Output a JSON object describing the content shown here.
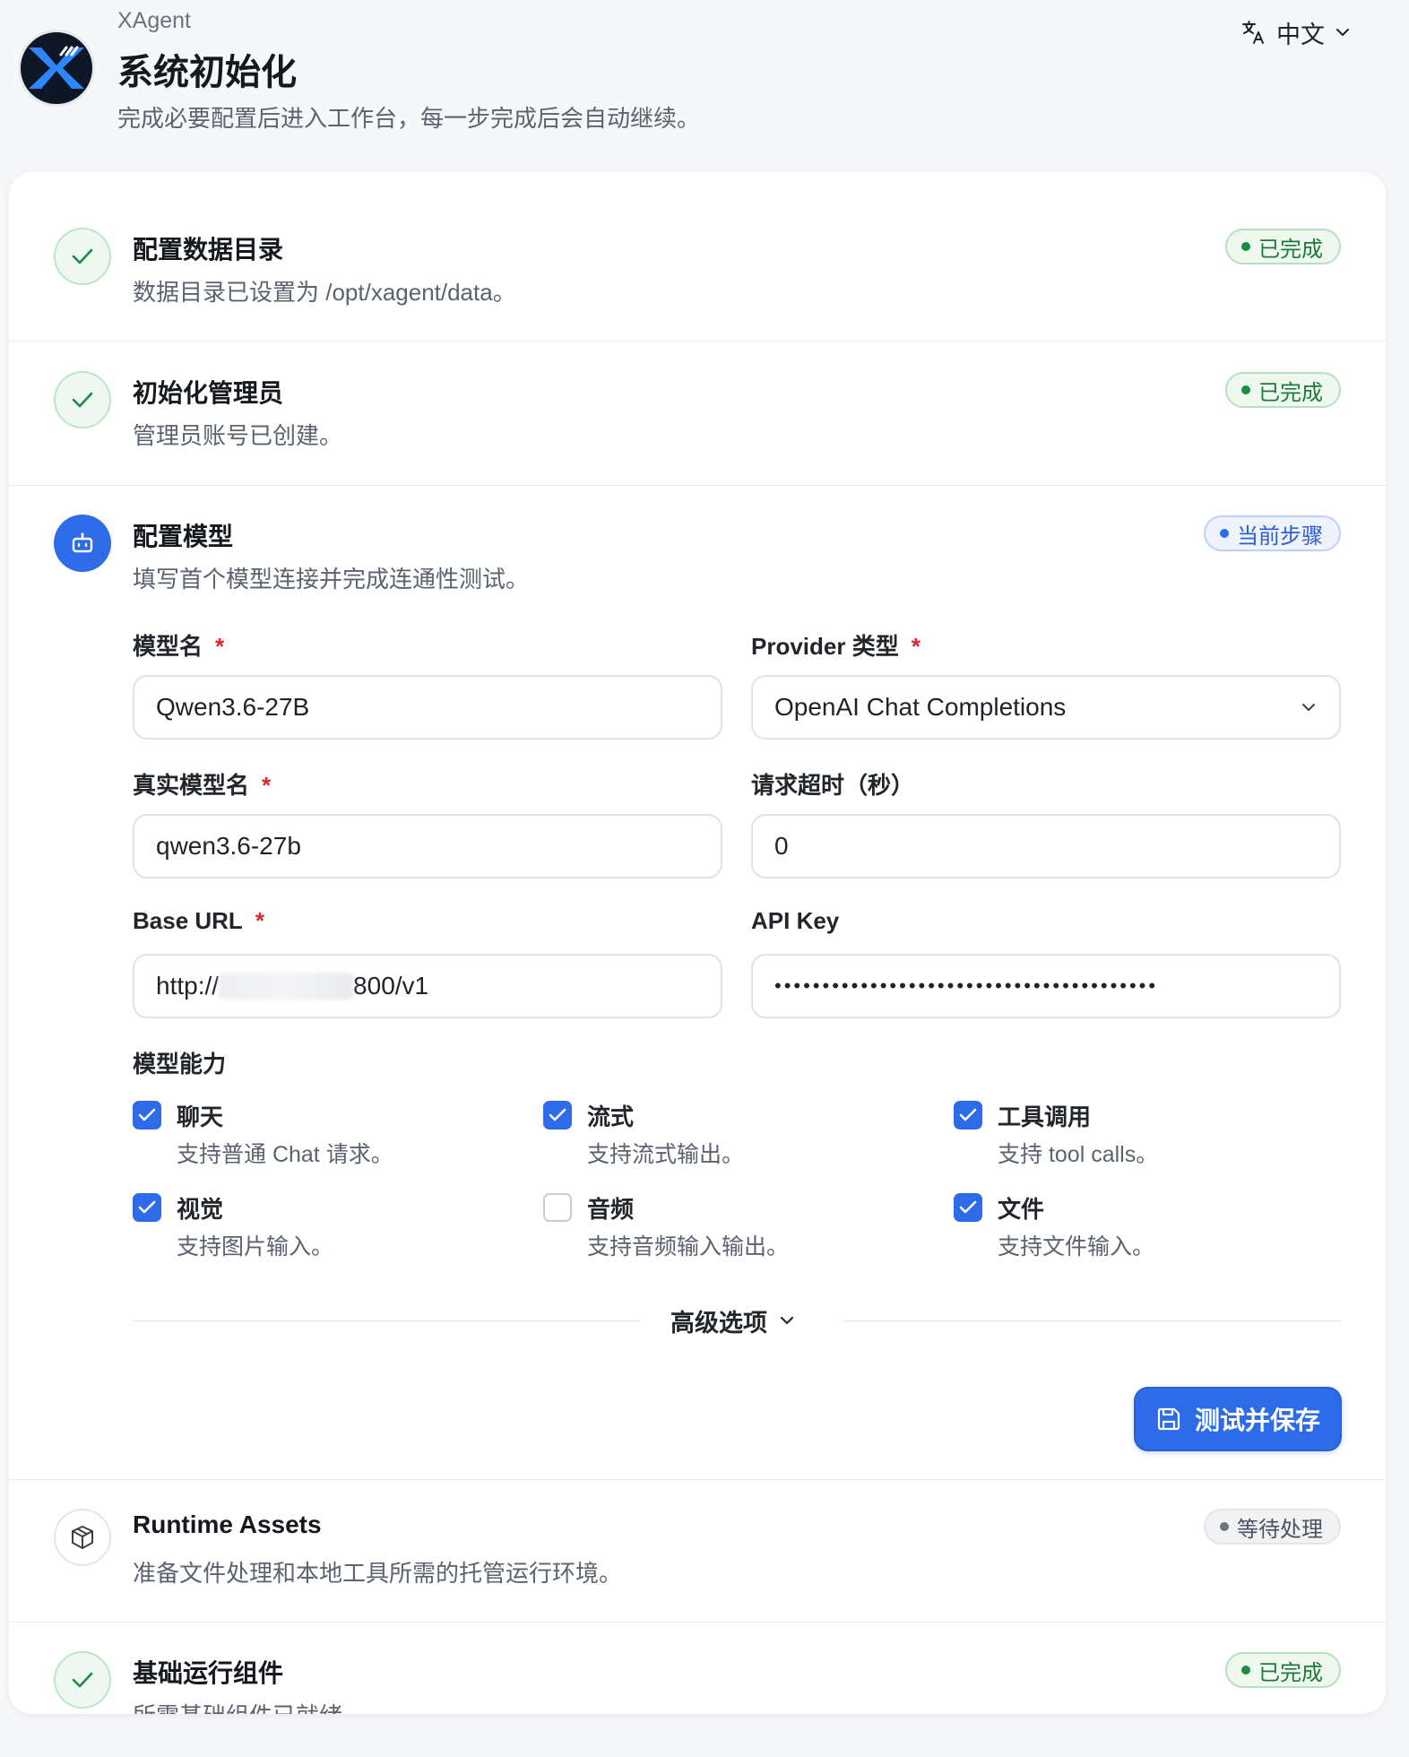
{
  "header": {
    "app_name": "XAgent",
    "title": "系统初始化",
    "subtitle": "完成必要配置后进入工作台，每一步完成后会自动继续。",
    "language": "中文"
  },
  "steps": [
    {
      "title": "配置数据目录",
      "desc": "数据目录已设置为 /opt/xagent/data。",
      "badge": "已完成",
      "status": "done",
      "icon": "check-icon"
    },
    {
      "title": "初始化管理员",
      "desc": "管理员账号已创建。",
      "badge": "已完成",
      "status": "done",
      "icon": "check-icon"
    },
    {
      "title": "配置模型",
      "desc": "填写首个模型连接并完成连通性测试。",
      "badge": "当前步骤",
      "status": "current",
      "icon": "robot-icon"
    },
    {
      "title": "Runtime Assets",
      "desc": "准备文件处理和本地工具所需的托管运行环境。",
      "badge": "等待处理",
      "status": "pending",
      "icon": "package-icon"
    },
    {
      "title": "基础运行组件",
      "desc": "所需基础组件已就绪。",
      "badge": "已完成",
      "status": "done",
      "icon": "check-icon"
    }
  ],
  "form": {
    "model_name": {
      "label": "模型名",
      "required": "*",
      "value": "Qwen3.6-27B"
    },
    "provider_type": {
      "label": "Provider 类型",
      "required": "*",
      "value": "OpenAI Chat Completions"
    },
    "real_model_name": {
      "label": "真实模型名",
      "required": "*",
      "value": "qwen3.6-27b"
    },
    "timeout": {
      "label": "请求超时（秒）",
      "value": "0"
    },
    "base_url": {
      "label": "Base URL",
      "required": "*",
      "value_prefix": "http://",
      "value_suffix": "800/v1"
    },
    "api_key": {
      "label": "API Key",
      "value": "••••••••••••••••••••••••••••••••••••••••"
    }
  },
  "capabilities": {
    "title": "模型能力",
    "items": [
      {
        "name": "聊天",
        "desc": "支持普通 Chat 请求。",
        "checked": true
      },
      {
        "name": "流式",
        "desc": "支持流式输出。",
        "checked": true
      },
      {
        "name": "工具调用",
        "desc": "支持 tool calls。",
        "checked": true
      },
      {
        "name": "视觉",
        "desc": "支持图片输入。",
        "checked": true
      },
      {
        "name": "音频",
        "desc": "支持音频输入输出。",
        "checked": false
      },
      {
        "name": "文件",
        "desc": "支持文件输入。",
        "checked": true
      }
    ]
  },
  "advanced": {
    "label": "高级选项"
  },
  "actions": {
    "save_label": "测试并保存"
  },
  "colors": {
    "primary": "#2d6be8",
    "success": "#1e8a42",
    "required": "#e0242b",
    "logo_bg": "#0e1726",
    "logo_accent": "#2f86ff"
  }
}
